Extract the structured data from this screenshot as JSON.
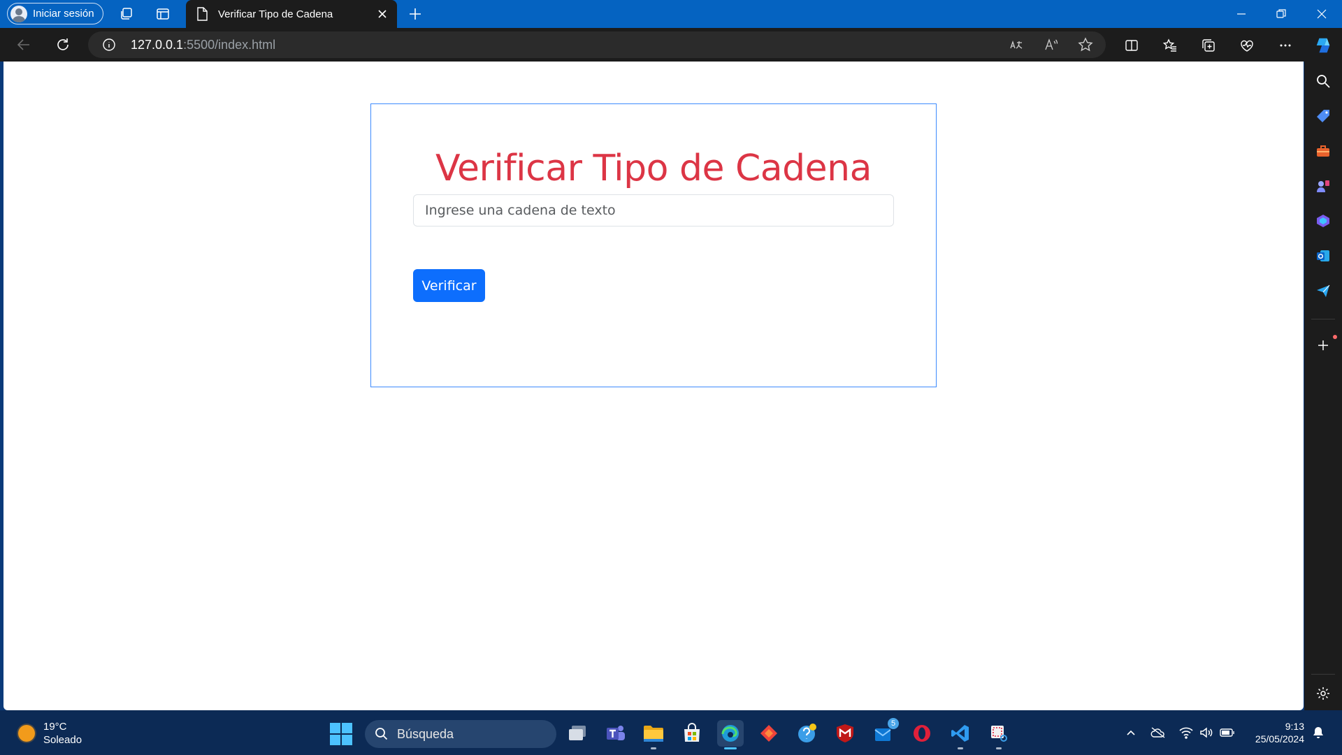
{
  "browser": {
    "profile_label": "Iniciar sesión",
    "tab_title": "Verificar Tipo de Cadena",
    "url_host": "127.0.0.1",
    "url_rest": ":5500/index.html",
    "accent": "#0563c1"
  },
  "page": {
    "title": "Verificar Tipo de Cadena",
    "input_placeholder": "Ingrese una cadena de texto",
    "input_value": "",
    "button_label": "Verificar",
    "title_color": "#dc3545",
    "button_color": "#0d6efd"
  },
  "sidebar": {
    "items": [
      "search-icon",
      "shopping-tag-icon",
      "tools-icon",
      "games-icon",
      "copilot-icon",
      "outlook-icon",
      "send-icon",
      "add-icon",
      "settings-icon"
    ]
  },
  "taskbar": {
    "weather_temp": "19°C",
    "weather_text": "Soleado",
    "search_label": "Búsqueda",
    "badge_count": "5",
    "time": "9:13",
    "date": "25/05/2024"
  }
}
